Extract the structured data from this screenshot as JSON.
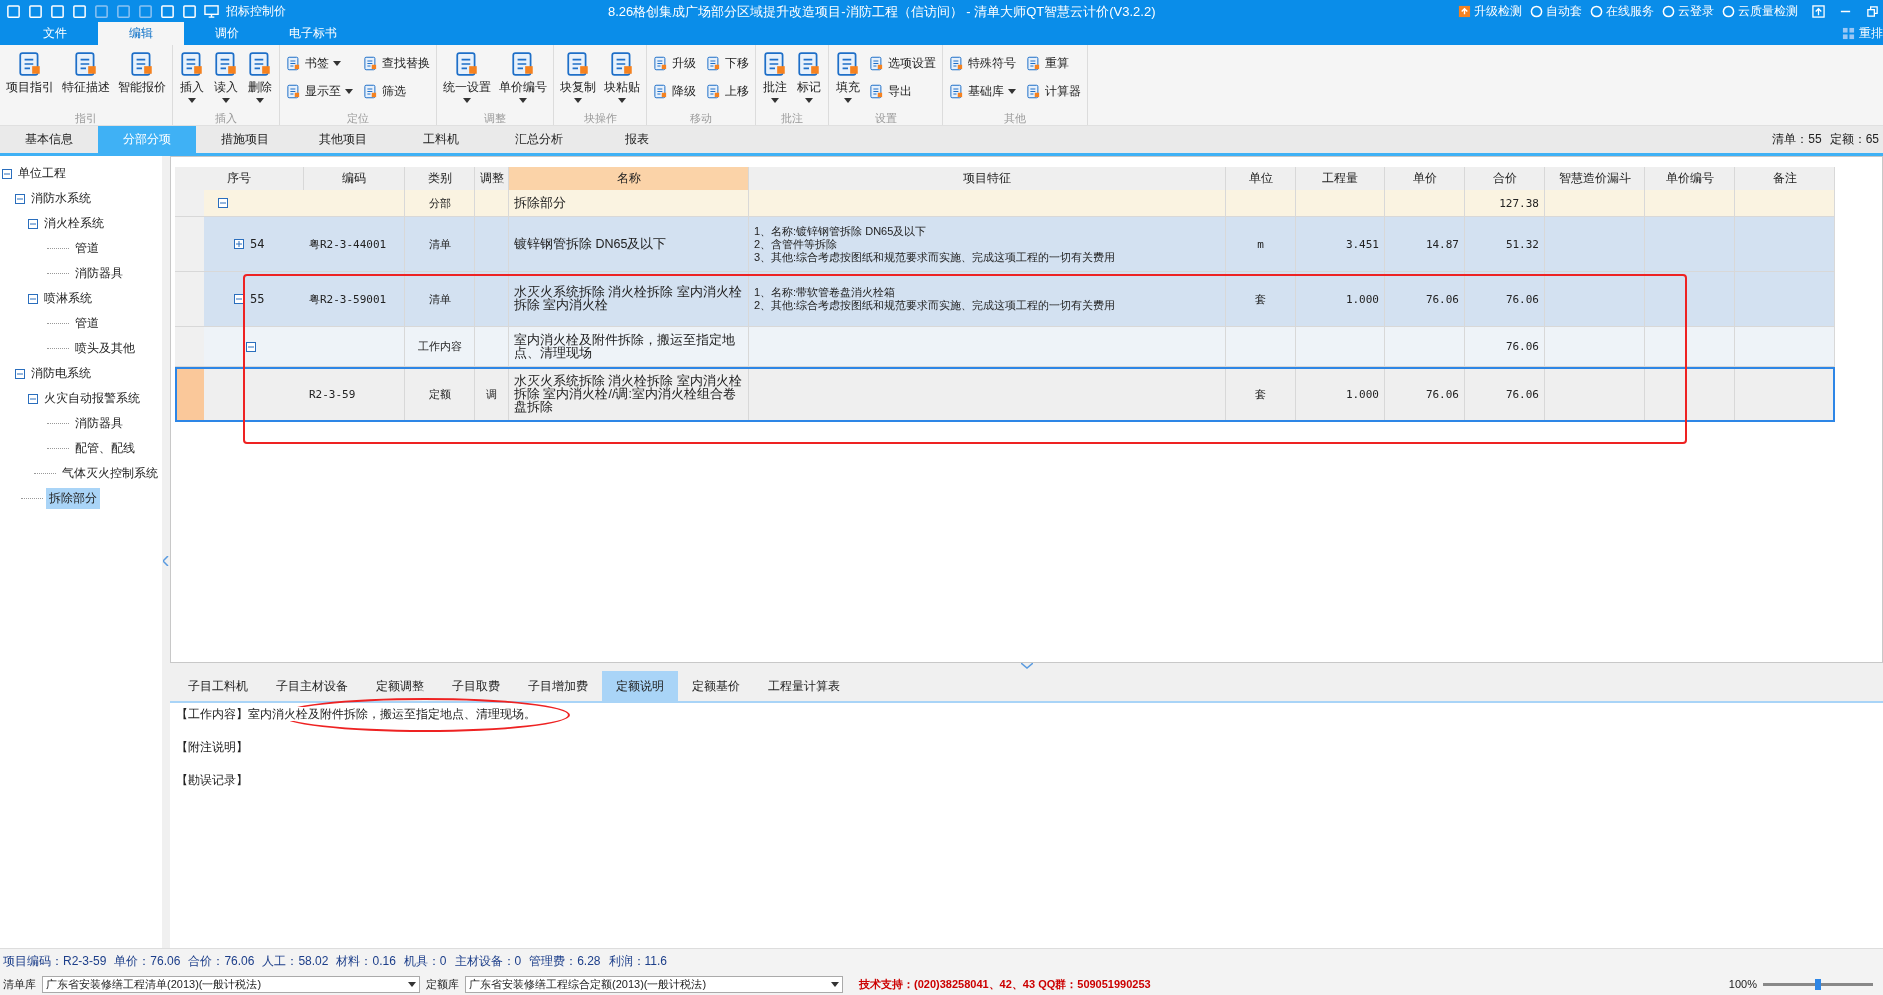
{
  "title_bar": {
    "mode": "招标控制价",
    "title": "8.26格创集成广场部分区域提升改造项目-消防工程（信访间） - 清单大师QT智慧云计价(V3.2.2)",
    "links": [
      "升级检测",
      "自动套",
      "在线服务",
      "云登录",
      "云质量检测"
    ],
    "arrange": "重排"
  },
  "menu_tabs": [
    {
      "label": "文件",
      "selected": false
    },
    {
      "label": "编辑",
      "selected": true
    },
    {
      "label": "调价",
      "selected": false
    },
    {
      "label": "电子标书",
      "selected": false
    }
  ],
  "ribbon": [
    {
      "label": "指引",
      "items": [
        {
          "label": "项目指引",
          "kind": "large",
          "dropdown": false
        },
        {
          "label": "特征描述",
          "kind": "large",
          "dropdown": false
        },
        {
          "label": "智能报价",
          "kind": "large",
          "dropdown": false
        }
      ]
    },
    {
      "label": "插入",
      "items": [
        {
          "label": "插入",
          "kind": "large",
          "dropdown": true
        },
        {
          "label": "读入",
          "kind": "large",
          "dropdown": true
        },
        {
          "label": "删除",
          "kind": "large",
          "dropdown": true
        }
      ]
    },
    {
      "label": "定位",
      "items": [
        {
          "label": "书签",
          "kind": "small",
          "dropdown": true
        },
        {
          "label": "显示至",
          "kind": "small",
          "dropdown": true
        },
        {
          "label": "查找替换",
          "kind": "small",
          "dropdown": false
        },
        {
          "label": "筛选",
          "kind": "small",
          "dropdown": false
        }
      ]
    },
    {
      "label": "调整",
      "items": [
        {
          "label": "统一设置",
          "kind": "large",
          "dropdown": true
        },
        {
          "label": "单价编号",
          "kind": "large",
          "dropdown": true
        }
      ]
    },
    {
      "label": "块操作",
      "items": [
        {
          "label": "块复制",
          "kind": "large",
          "dropdown": true
        },
        {
          "label": "块粘贴",
          "kind": "large",
          "dropdown": true
        }
      ]
    },
    {
      "label": "移动",
      "items": [
        {
          "label": "升级",
          "kind": "small",
          "dropdown": false
        },
        {
          "label": "降级",
          "kind": "small",
          "dropdown": false
        },
        {
          "label": "下移",
          "kind": "small",
          "dropdown": false
        },
        {
          "label": "上移",
          "kind": "small",
          "dropdown": false
        }
      ]
    },
    {
      "label": "批注",
      "items": [
        {
          "label": "批注",
          "kind": "large",
          "dropdown": true
        },
        {
          "label": "标记",
          "kind": "large",
          "dropdown": true
        }
      ]
    },
    {
      "label": "设置",
      "items": [
        {
          "label": "填充",
          "kind": "large",
          "dropdown": true
        },
        {
          "label": "选项设置",
          "kind": "small",
          "dropdown": false
        },
        {
          "label": "导出",
          "kind": "small",
          "dropdown": false
        }
      ]
    },
    {
      "label": "其他",
      "items": [
        {
          "label": "特殊符号",
          "kind": "small",
          "dropdown": false
        },
        {
          "label": "基础库",
          "kind": "small",
          "dropdown": true
        },
        {
          "label": "重算",
          "kind": "small",
          "dropdown": false
        },
        {
          "label": "计算器",
          "kind": "small",
          "dropdown": false
        }
      ]
    }
  ],
  "view_tabs": [
    {
      "label": "基本信息",
      "selected": false
    },
    {
      "label": "分部分项",
      "selected": true
    },
    {
      "label": "措施项目",
      "selected": false
    },
    {
      "label": "其他项目",
      "selected": false
    },
    {
      "label": "工料机",
      "selected": false
    },
    {
      "label": "汇总分析",
      "selected": false
    },
    {
      "label": "报表",
      "selected": false
    }
  ],
  "counts": [
    "清单：55",
    "定额：65"
  ],
  "tree": [
    {
      "label": "单位工程",
      "expanded": true,
      "selected": false,
      "children": [
        {
          "label": "消防水系统",
          "expanded": true,
          "selected": false,
          "children": [
            {
              "label": "消火栓系统",
              "expanded": true,
              "selected": false,
              "children": [
                {
                  "label": "管道",
                  "selected": false
                },
                {
                  "label": "消防器具",
                  "selected": false
                }
              ]
            },
            {
              "label": "喷淋系统",
              "expanded": true,
              "selected": false,
              "children": [
                {
                  "label": "管道",
                  "selected": false
                },
                {
                  "label": "喷头及其他",
                  "selected": false
                }
              ]
            }
          ]
        },
        {
          "label": "消防电系统",
          "expanded": true,
          "selected": false,
          "children": [
            {
              "label": "火灾自动报警系统",
              "expanded": true,
              "selected": false,
              "children": [
                {
                  "label": "消防器具",
                  "selected": false
                },
                {
                  "label": "配管、配线",
                  "selected": false
                }
              ]
            },
            {
              "label": "气体灭火控制系统",
              "selected": false
            }
          ]
        },
        {
          "label": "拆除部分",
          "selected": true
        }
      ]
    }
  ],
  "table": {
    "columns": [
      {
        "label": "序号",
        "highlighted": false
      },
      {
        "label": "编码",
        "highlighted": false
      },
      {
        "label": "类别",
        "highlighted": false
      },
      {
        "label": "调整",
        "highlighted": false
      },
      {
        "label": "名称",
        "highlighted": true
      },
      {
        "label": "项目特征",
        "highlighted": false
      },
      {
        "label": "单位",
        "highlighted": false
      },
      {
        "label": "工程量",
        "highlighted": false
      },
      {
        "label": "单价",
        "highlighted": false
      },
      {
        "label": "合价",
        "highlighted": false
      },
      {
        "label": "智慧造价漏斗",
        "highlighted": false
      },
      {
        "label": "单价编号",
        "highlighted": false
      },
      {
        "label": "备注",
        "highlighted": false
      }
    ],
    "rows": [
      {
        "kind": "section",
        "expanded": true,
        "selected": false,
        "type": "分部",
        "name": "拆除部分",
        "total": "127.38"
      },
      {
        "kind": "bill",
        "expanded": false,
        "selected": false,
        "number": "54",
        "code": "粤R2-3-44001",
        "type": "清单",
        "name": "镀锌钢管拆除 DN65及以下",
        "features": [
          "1、名称:镀锌钢管拆除 DN65及以下",
          "2、含管件等拆除",
          "3、其他:综合考虑按图纸和规范要求而实施、完成这项工程的一切有关费用"
        ],
        "unit": "m",
        "quantity": "3.451",
        "unit_price": "14.87",
        "total": "51.32"
      },
      {
        "kind": "bill",
        "expanded": true,
        "selected": false,
        "number": "55",
        "code": "粤R2-3-59001",
        "type": "清单",
        "name": "水灭火系统拆除 消火栓拆除 室内消火栓拆除 室内消火栓",
        "features": [
          "1、名称:带软管卷盘消火栓箱",
          "2、其他:综合考虑按图纸和规范要求而实施、完成这项工程的一切有关费用"
        ],
        "unit": "套",
        "quantity": "1.000",
        "unit_price": "76.06",
        "total": "76.06"
      },
      {
        "kind": "work",
        "expanded": true,
        "selected": false,
        "type": "工作内容",
        "name": "室内消火栓及附件拆除，搬运至指定地点、清理现场",
        "total": "76.06"
      },
      {
        "kind": "quota",
        "selected": true,
        "code": "R2-3-59",
        "type": "定额",
        "adjust": "调",
        "name": "水灭火系统拆除 消火栓拆除 室内消火栓拆除 室内消火栓//调:室内消火栓组合卷盘拆除",
        "unit": "套",
        "quantity": "1.000",
        "unit_price": "76.06",
        "total": "76.06"
      }
    ]
  },
  "detail_tabs": [
    {
      "label": "子目工料机",
      "selected": false
    },
    {
      "label": "子目主材设备",
      "selected": false
    },
    {
      "label": "定额调整",
      "selected": false
    },
    {
      "label": "子目取费",
      "selected": false
    },
    {
      "label": "子目增加费",
      "selected": false
    },
    {
      "label": "定额说明",
      "selected": true
    },
    {
      "label": "定额基价",
      "selected": false
    },
    {
      "label": "工程量计算表",
      "selected": false
    }
  ],
  "detail_text": [
    "【工作内容】室内消火栓及附件拆除，搬运至指定地点、清理现场。",
    "【附注说明】",
    "【勘误记录】"
  ],
  "annotations": [
    {
      "kind": "rectangle",
      "color": "#ee2222"
    },
    {
      "kind": "ellipse",
      "color": "#ee2222"
    }
  ],
  "status_bar": [
    "项目编码：R2-3-59",
    "单价：76.06",
    "合价：76.06",
    "人工：58.02",
    "材料：0.16",
    "机具：0",
    "主材设备：0",
    "管理费：6.28",
    "利润：11.6"
  ],
  "library_bar": {
    "bill_label": "清单库",
    "bill_value": "广东省安装修缮工程清单(2013)(一般计税法)",
    "quota_label": "定额库",
    "quota_value": "广东省安装修缮工程综合定额(2013)(一般计税法)",
    "support": "技术支持：(020)38258041、42、43 QQ群：509051990253",
    "zoom": "100%",
    "zoom_slider": {
      "level": 0.5
    }
  }
}
